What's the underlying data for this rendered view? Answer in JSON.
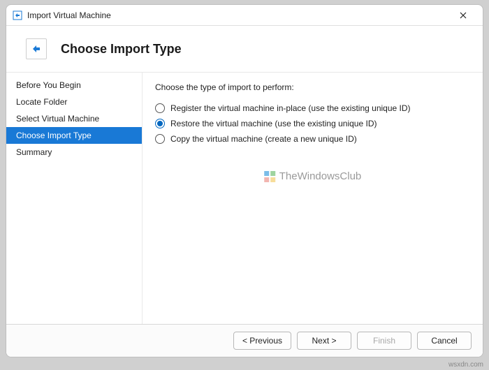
{
  "window": {
    "title": "Import Virtual Machine"
  },
  "header": {
    "page_title": "Choose Import Type"
  },
  "sidebar": {
    "steps": [
      {
        "label": "Before You Begin",
        "active": false
      },
      {
        "label": "Locate Folder",
        "active": false
      },
      {
        "label": "Select Virtual Machine",
        "active": false
      },
      {
        "label": "Choose Import Type",
        "active": true
      },
      {
        "label": "Summary",
        "active": false
      }
    ]
  },
  "content": {
    "instruction": "Choose the type of import to perform:",
    "options": [
      {
        "label": "Register the virtual machine in-place (use the existing unique ID)",
        "selected": false
      },
      {
        "label": "Restore the virtual machine (use the existing unique ID)",
        "selected": true
      },
      {
        "label": "Copy the virtual machine (create a new unique ID)",
        "selected": false
      }
    ]
  },
  "watermark": {
    "text": "TheWindowsClub"
  },
  "buttons": {
    "previous": "< Previous",
    "next": "Next >",
    "finish": "Finish",
    "cancel": "Cancel"
  },
  "credit": "wsxdn.com"
}
